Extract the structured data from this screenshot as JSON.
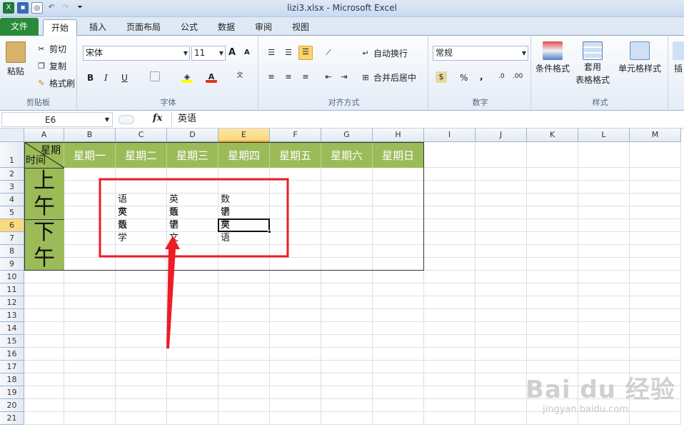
{
  "window": {
    "title": "lizi3.xlsx  -  Microsoft Excel"
  },
  "tabs": [
    "文件",
    "开始",
    "插入",
    "页面布局",
    "公式",
    "数据",
    "审阅",
    "视图"
  ],
  "ribbon": {
    "clipboard": {
      "paste": "粘贴",
      "cut": "剪切",
      "copy": "复制",
      "format_painter": "格式刷",
      "label": "剪贴板"
    },
    "font": {
      "name": "宋体",
      "size": "11",
      "label": "字体",
      "bold": "B",
      "italic": "I",
      "underline": "U",
      "grow": "A",
      "shrink": "A"
    },
    "alignment": {
      "wrap": "自动换行",
      "merge": "合并后居中",
      "label": "对齐方式"
    },
    "number": {
      "format": "常规",
      "label": "数字",
      "percent": "%",
      "comma": ","
    },
    "styles": {
      "cond": "条件格式",
      "table1": "套用",
      "table2": "表格格式",
      "cell": "单元格样式",
      "label": "样式"
    },
    "insert": "插"
  },
  "formula_bar": {
    "name_box": "E6",
    "fx": "fx",
    "content": "英语"
  },
  "columns": [
    "A",
    "B",
    "C",
    "D",
    "E",
    "F",
    "G",
    "H",
    "I",
    "J",
    "K",
    "L",
    "M"
  ],
  "rows": [
    "1",
    "2",
    "3",
    "4",
    "5",
    "6",
    "7",
    "8",
    "9",
    "10",
    "11",
    "12",
    "13",
    "14",
    "15",
    "16",
    "17",
    "18",
    "19",
    "20",
    "21"
  ],
  "selected": {
    "col": "E",
    "row": "6"
  },
  "sheet": {
    "header_a1_top": "星期",
    "header_a1_bottom": "时间",
    "weekdays": [
      "星期一",
      "星期二",
      "星期三",
      "星期四",
      "星期五",
      "星期六",
      "星期日"
    ],
    "morning": [
      "上",
      "午"
    ],
    "afternoon": [
      "下",
      "午"
    ],
    "schedule": [
      {
        "col": "C",
        "row": "4",
        "text": "语文"
      },
      {
        "col": "C",
        "row": "5",
        "text": "英语"
      },
      {
        "col": "C",
        "row": "6",
        "text": "数学"
      },
      {
        "col": "D",
        "row": "4",
        "text": "英语"
      },
      {
        "col": "D",
        "row": "5",
        "text": "数学"
      },
      {
        "col": "D",
        "row": "6",
        "text": "语文"
      },
      {
        "col": "E",
        "row": "4",
        "text": "数学"
      },
      {
        "col": "E",
        "row": "5",
        "text": "语文"
      },
      {
        "col": "E",
        "row": "6",
        "text": "英语"
      }
    ]
  },
  "colors": {
    "header_green": "#9bbb59",
    "annotation_red": "#ee1c25",
    "file_tab": "#2a8a3a"
  },
  "watermark": {
    "brand": "Bai du 经验",
    "url": "jingyan.baidu.com"
  }
}
